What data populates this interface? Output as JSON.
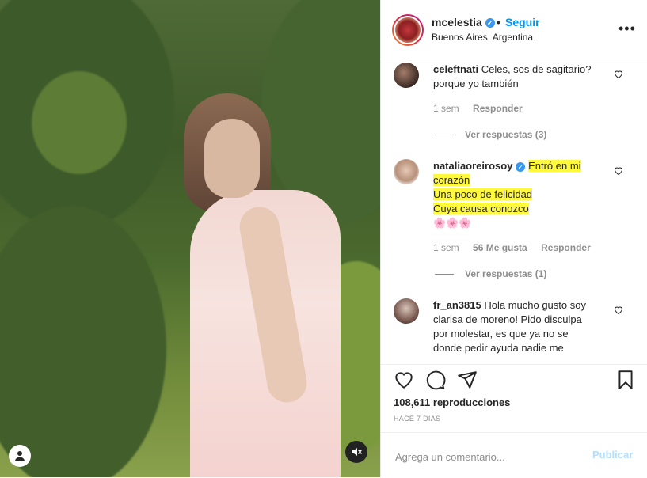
{
  "header": {
    "username": "mcelestia",
    "separator": "•",
    "follow_label": "Seguir",
    "location": "Buenos Aires, Argentina",
    "more_icon": "more-horizontal-icon"
  },
  "comments": [
    {
      "username": "celeftnati",
      "verified": false,
      "text_lines": [
        "Celes, sos de sagitario?",
        "porque yo también"
      ],
      "time": "1 sem",
      "likes": "",
      "reply_label": "Responder",
      "view_replies": "Ver respuestas (3)"
    },
    {
      "username": "nataliaoreirosoy",
      "verified": true,
      "text_lines": [
        "Entró en mi",
        "corazón",
        "Una poco de felicidad",
        "Cuya causa conozco",
        "🌸🌸🌸"
      ],
      "time": "1 sem",
      "likes": "56 Me gusta",
      "reply_label": "Responder",
      "view_replies": "Ver respuestas (1)"
    },
    {
      "username": "fr_an3815",
      "verified": false,
      "text_lines": [
        "Hola mucho gusto soy",
        "clarisa de moreno! Pido disculpa",
        "por molestar, es que ya no se",
        "donde pedir ayuda nadie me"
      ],
      "time": "",
      "likes": "",
      "reply_label": "",
      "view_replies": ""
    }
  ],
  "actions": {
    "icons": [
      "heart-icon",
      "comment-icon",
      "share-icon",
      "bookmark-icon"
    ],
    "views": "108,611 reproducciones",
    "time_ago": "HACE 7 DÍAS"
  },
  "add_comment": {
    "placeholder": "Agrega un comentario...",
    "publish_label": "Publicar"
  },
  "colors": {
    "accent": "#0095f6",
    "highlight": "#fff93d",
    "verified": "#3897f0"
  }
}
